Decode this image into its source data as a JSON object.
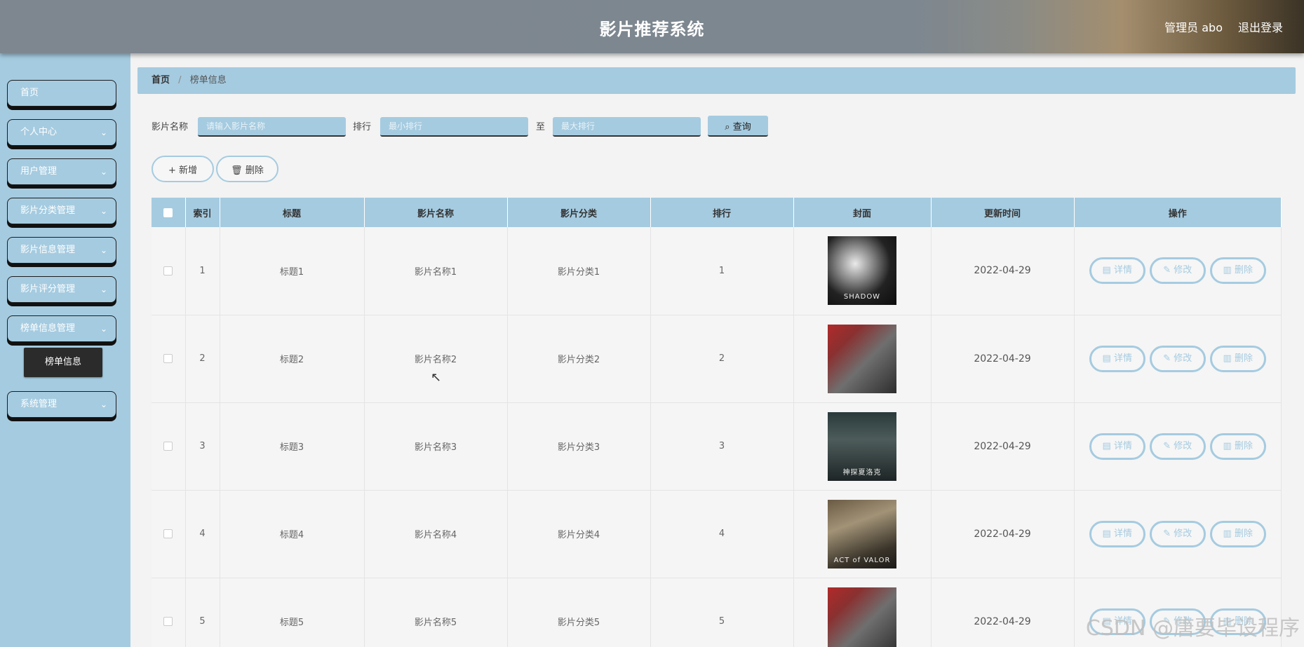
{
  "header": {
    "title": "影片推荐系统",
    "user": "管理员 abo",
    "logout": "退出登录"
  },
  "sidebar": {
    "items": [
      {
        "label": "首页",
        "has_chevron": false
      },
      {
        "label": "个人中心",
        "has_chevron": true
      },
      {
        "label": "用户管理",
        "has_chevron": true
      },
      {
        "label": "影片分类管理",
        "has_chevron": true
      },
      {
        "label": "影片信息管理",
        "has_chevron": true
      },
      {
        "label": "影片评分管理",
        "has_chevron": true
      },
      {
        "label": "榜单信息管理",
        "has_chevron": true
      },
      {
        "label": "系统管理",
        "has_chevron": true
      }
    ],
    "active_sub": "榜单信息",
    "chevron": "⌄"
  },
  "breadcrumb": {
    "home": "首页",
    "separator": "/",
    "current": "榜单信息"
  },
  "search": {
    "name_label": "影片名称",
    "name_placeholder": "请输入影片名称",
    "rank_label": "排行",
    "rank_min_placeholder": "最小排行",
    "to_label": "至",
    "rank_max_placeholder": "最大排行",
    "query_label": "查询",
    "query_icon": "search-icon"
  },
  "actions": {
    "add_label": "新增",
    "delete_label": "删除"
  },
  "table": {
    "headers": [
      "索引",
      "标题",
      "影片名称",
      "影片分类",
      "排行",
      "封面",
      "更新时间",
      "操作"
    ],
    "rows": [
      {
        "index": "1",
        "title": "标题1",
        "name": "影片名称1",
        "category": "影片分类1",
        "rank": "1",
        "cover_text": "SHADOW",
        "date": "2022-04-29"
      },
      {
        "index": "2",
        "title": "标题2",
        "name": "影片名称2",
        "category": "影片分类2",
        "rank": "2",
        "cover_text": "",
        "date": "2022-04-29"
      },
      {
        "index": "3",
        "title": "标题3",
        "name": "影片名称3",
        "category": "影片分类3",
        "rank": "3",
        "cover_text": "神探夏洛克",
        "date": "2022-04-29"
      },
      {
        "index": "4",
        "title": "标题4",
        "name": "影片名称4",
        "category": "影片分类4",
        "rank": "4",
        "cover_text": "ACT of VALOR",
        "date": "2022-04-29"
      },
      {
        "index": "5",
        "title": "标题5",
        "name": "影片名称5",
        "category": "影片分类5",
        "rank": "5",
        "cover_text": "",
        "date": "2022-04-29"
      }
    ],
    "ops": {
      "detail": "详情",
      "edit": "修改",
      "delete": "删除"
    }
  },
  "watermark": "CSDN @唐要毕设程序",
  "colors": {
    "accent": "#a5cbe0",
    "sub_active_bg": "#2b2b2b"
  }
}
